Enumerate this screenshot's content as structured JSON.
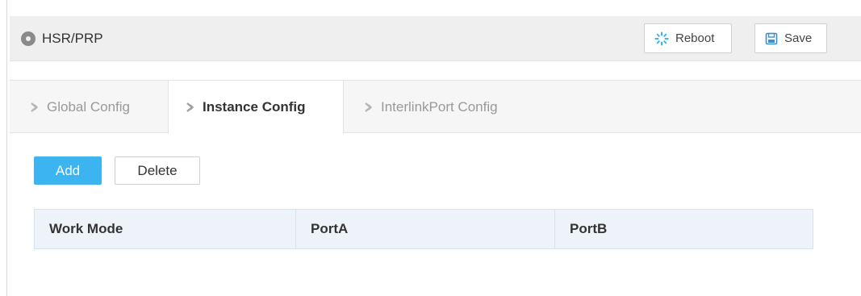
{
  "header": {
    "title": "HSR/PRP",
    "title_icon": "location-pin-icon",
    "reboot_label": "Reboot",
    "reboot_icon": "spinner-icon",
    "save_label": "Save",
    "save_icon": "floppy-disk-icon"
  },
  "tabs": [
    {
      "label": "Global Config",
      "icon": "chevron-right-icon",
      "active": false
    },
    {
      "label": "Instance Config",
      "icon": "chevron-right-icon",
      "active": true
    },
    {
      "label": "InterlinkPort Config",
      "icon": "chevron-right-icon",
      "active": false
    }
  ],
  "actions": {
    "add_label": "Add",
    "delete_label": "Delete"
  },
  "table": {
    "columns": [
      "Work Mode",
      "PortA",
      "PortB"
    ],
    "rows": []
  },
  "colors": {
    "accent": "#3cb4f0",
    "header_bg": "#efefef",
    "table_header_bg": "#edf3f8"
  }
}
